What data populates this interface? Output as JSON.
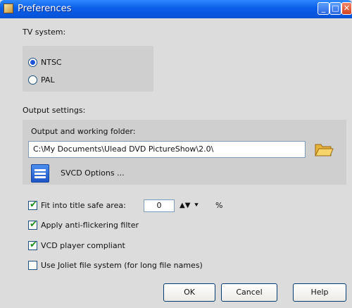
{
  "window": {
    "title": "Preferences"
  },
  "tv_system": {
    "heading": "TV system:",
    "options": [
      {
        "label": "NTSC",
        "selected": true
      },
      {
        "label": "PAL",
        "selected": false
      }
    ]
  },
  "output": {
    "heading": "Output settings:",
    "folder_label": "Output and working folder:",
    "folder_value": "C:\\My Documents\\Ulead DVD PictureShow\\2.0\\",
    "svcd_label": "SVCD Options ..."
  },
  "options": {
    "fit_title_safe": {
      "label": "Fit into title safe area:",
      "checked": true,
      "value": "0",
      "unit": "%"
    },
    "anti_flicker": {
      "label": "Apply anti-flickering filter",
      "checked": true
    },
    "vcd_compliant": {
      "label": "VCD player compliant",
      "checked": true
    },
    "joliet": {
      "label": "Use Joliet file system (for long file names)",
      "checked": false
    }
  },
  "buttons": {
    "ok": "OK",
    "cancel": "Cancel",
    "help": "Help"
  },
  "icons": {
    "folder": "folder-open-icon",
    "svcd": "svcd-options-icon",
    "app": "app-icon"
  },
  "colors": {
    "titlebar": "#0a5ee8",
    "window_bg": "#dcdcdc",
    "panel_bg": "#cfcfcf"
  }
}
